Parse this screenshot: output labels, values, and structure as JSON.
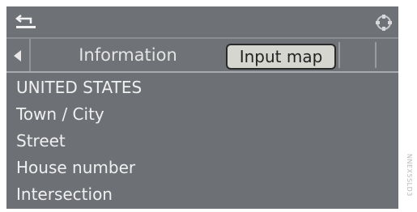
{
  "header": {
    "back_icon": "back-arrow-icon",
    "dial_icon": "controller-dial-icon"
  },
  "tabs": {
    "left_icon": "arrow-left-icon",
    "items": [
      {
        "label": "Information",
        "selected": false
      },
      {
        "label": "Input map",
        "selected": true
      }
    ]
  },
  "menu": {
    "items": [
      {
        "label": "UNITED STATES"
      },
      {
        "label": "Town / City"
      },
      {
        "label": "Street"
      },
      {
        "label": "House number"
      },
      {
        "label": "Intersection"
      }
    ]
  },
  "watermark": {
    "text": "NNEX5SLD3"
  },
  "colors": {
    "screen_bg": "#6d7075",
    "selected_tab_bg": "#d6d6d1",
    "text": "#f0f0f0"
  }
}
